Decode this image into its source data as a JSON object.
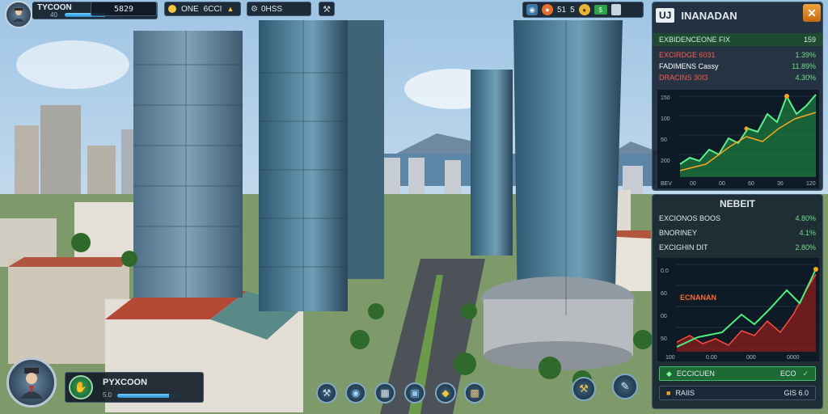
{
  "player": {
    "title": "TYCOON",
    "level": "40",
    "xp": 0.72
  },
  "topbar": {
    "stat_a": {
      "value": "5829",
      "icon": "building-icon"
    },
    "stat_b": {
      "label": "ONE",
      "value": "6CCI"
    },
    "stat_c": {
      "label": "0HSS"
    },
    "tools_icon": "wrench-icon",
    "res_a": "51",
    "res_b": "5"
  },
  "finance_panel": {
    "logo": "UJ",
    "title": "INANADAN",
    "header": {
      "label": "EXBIDENCEONE FIX",
      "value": "159"
    },
    "rows": [
      {
        "label": "EXCIRDGE 6031",
        "value": "1.39%",
        "color": "#ff5a4a"
      },
      {
        "label": "FADIMENS Cassy",
        "value": "11.89%",
        "color": "#ffffff"
      },
      {
        "label": "DRACINS 30I3",
        "value": "4.30%",
        "color": "#ff5a4a"
      }
    ],
    "chart_ticks_y": [
      "150",
      "100",
      "50",
      "200"
    ],
    "chart_ticks_x": [
      "BEV",
      "00",
      "00",
      "60",
      "36",
      "120"
    ]
  },
  "invest_panel": {
    "title": "NEBEIT",
    "rows": [
      {
        "label": "EXCIONOS BOOS",
        "value": "4.80%"
      },
      {
        "label": "BNORINEY",
        "value": "4.1%"
      },
      {
        "label": "EXCIGHIN DIT",
        "value": "2.80%"
      }
    ],
    "chart_label": "ECNANAN",
    "chart_ticks_y": [
      "0.0",
      "60",
      "00",
      "50"
    ],
    "chart_ticks_x": [
      "100",
      "0.00",
      "000",
      "0000"
    ],
    "button_a": {
      "label": "ECCICUEN",
      "value": "ECO"
    },
    "button_b": {
      "label": "RAIIS",
      "value": "GIS 6.0"
    }
  },
  "bottom_card": {
    "title": "PYXCOON",
    "level": "5.0",
    "progress": 0.8
  },
  "toolbar": [
    "wrench-icon",
    "globe-icon",
    "crate-icon",
    "box-icon",
    "gold-icon",
    "cargo-icon",
    "gavel-icon",
    "tools-icon"
  ],
  "colors": {
    "accent": "#4fc3f7",
    "gain": "#2ecc71",
    "loss": "#e74c3c",
    "warn": "#f5a623"
  }
}
